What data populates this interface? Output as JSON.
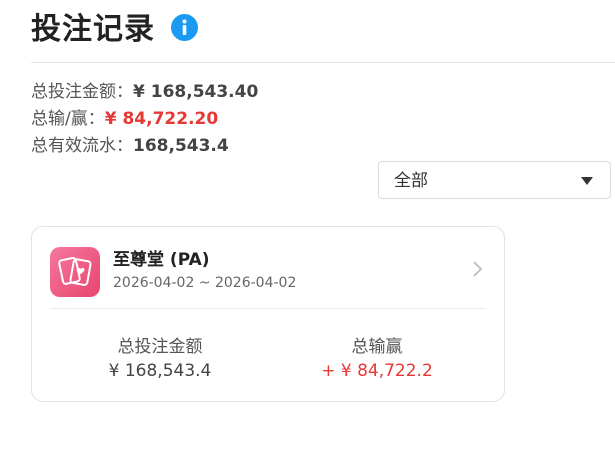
{
  "page": {
    "title": "投注记录",
    "info_icon": "info-icon"
  },
  "summary": {
    "total_bet_label": "总投注金额：",
    "total_bet_value": "¥ 168,543.40",
    "win_loss_label": "总输/赢：",
    "win_loss_value": "¥ 84,722.20",
    "valid_turnover_label": "总有效流水：",
    "valid_turnover_value": "168,543.4"
  },
  "filter": {
    "selected": "全部",
    "caret_icon": "caret-down-icon"
  },
  "records": [
    {
      "game_name": "至尊堂 (PA)",
      "date_range": "2026-04-02 ~ 2026-04-02",
      "icon": "playing-cards-icon",
      "bet_label": "总投注金额",
      "bet_value": "¥ 168,543.4",
      "win_label": "总输赢",
      "win_value": "+ ¥ 84,722.2"
    }
  ],
  "colors": {
    "accent_blue": "#1a9af0",
    "negative_red": "#e53935",
    "icon_pink": "#f0607f"
  }
}
